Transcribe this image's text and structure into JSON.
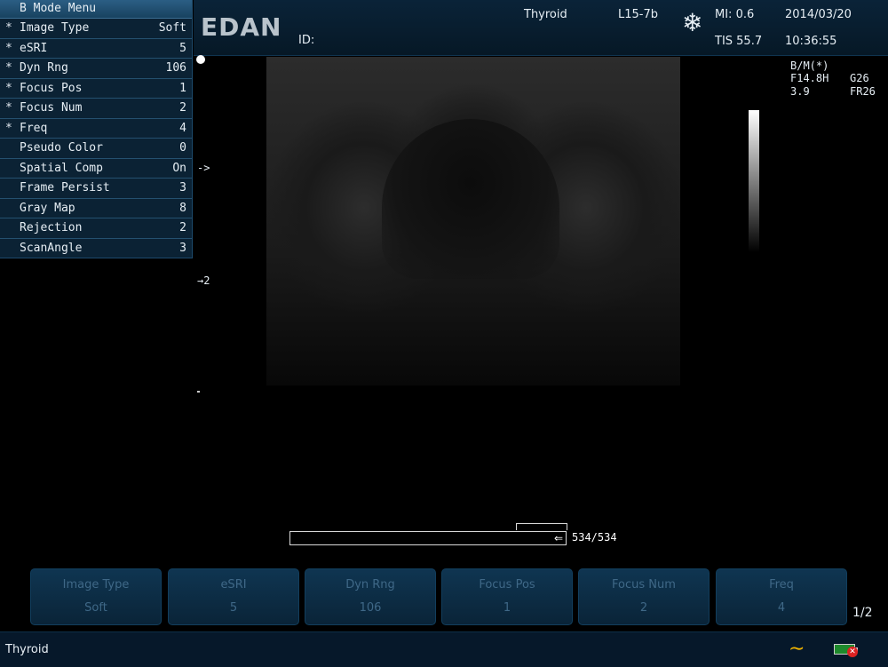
{
  "header": {
    "logo": "EDAN",
    "id_label": "ID:",
    "exam": "Thyroid",
    "probe": "L15-7b",
    "mi": "MI: 0.6",
    "tis": "TIS 55.7",
    "date": "2014/03/20",
    "time": "10:36:55",
    "freeze_icon": "snowflake-icon"
  },
  "menu": {
    "title": "B Mode Menu",
    "items": [
      {
        "star": "*",
        "label": "Image Type",
        "value": "Soft"
      },
      {
        "star": "*",
        "label": "eSRI",
        "value": "5"
      },
      {
        "star": "*",
        "label": "Dyn Rng",
        "value": "106"
      },
      {
        "star": "*",
        "label": "Focus Pos",
        "value": "1"
      },
      {
        "star": "*",
        "label": "Focus Num",
        "value": "2"
      },
      {
        "star": "*",
        "label": "Freq",
        "value": "4"
      },
      {
        "star": "",
        "label": "Pseudo Color",
        "value": "0"
      },
      {
        "star": "",
        "label": "Spatial Comp",
        "value": "On"
      },
      {
        "star": "",
        "label": "Frame Persist",
        "value": "3"
      },
      {
        "star": "",
        "label": "Gray Map",
        "value": "8"
      },
      {
        "star": "",
        "label": "Rejection",
        "value": "2"
      },
      {
        "star": "",
        "label": "ScanAngle",
        "value": "3"
      }
    ]
  },
  "image": {
    "focus_marker_1": "->",
    "focus_marker_2": "→2",
    "mode": "B/M(*)",
    "freq": "F14.8H",
    "gain": "G26",
    "depth": "3.9",
    "frame_rate": "FR26"
  },
  "cine": {
    "count": "534/534",
    "arrow": "⇐"
  },
  "softkeys": [
    {
      "label": "Image Type",
      "value": "Soft"
    },
    {
      "label": "eSRI",
      "value": "5"
    },
    {
      "label": "Dyn Rng",
      "value": "106"
    },
    {
      "label": "Focus Pos",
      "value": "1"
    },
    {
      "label": "Focus Num",
      "value": "2"
    },
    {
      "label": "Freq",
      "value": "4"
    }
  ],
  "page_indicator": "1/2",
  "status": {
    "text": "Thyroid",
    "wave_icon": "ac-wave-icon",
    "battery_icon": "battery-icon"
  }
}
